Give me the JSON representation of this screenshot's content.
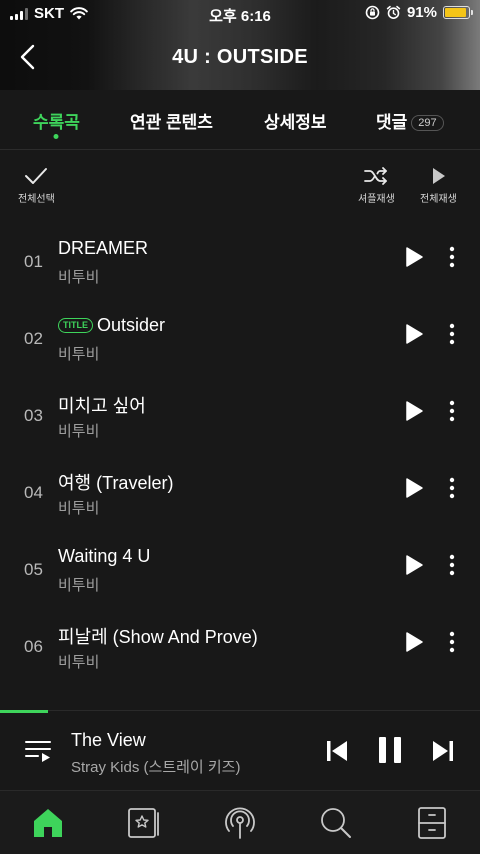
{
  "status_bar": {
    "carrier": "SKT",
    "time": "오후 6:16",
    "battery": "91%"
  },
  "header": {
    "title": "4U : OUTSIDE"
  },
  "tabs": [
    {
      "label": "수록곡",
      "active": true
    },
    {
      "label": "연관 콘텐츠",
      "active": false
    },
    {
      "label": "상세정보",
      "active": false
    },
    {
      "label": "댓글",
      "active": false,
      "count": "297"
    }
  ],
  "toolbar": {
    "select_all": "전체선택",
    "shuffle": "셔플재생",
    "play_all": "전체재생"
  },
  "tracks": [
    {
      "num": "01",
      "title": "DREAMER",
      "artist": "비투비",
      "badge": ""
    },
    {
      "num": "02",
      "title": "Outsider",
      "artist": "비투비",
      "badge": "TITLE"
    },
    {
      "num": "03",
      "title": "미치고 싶어",
      "artist": "비투비",
      "badge": ""
    },
    {
      "num": "04",
      "title": "여행 (Traveler)",
      "artist": "비투비",
      "badge": ""
    },
    {
      "num": "05",
      "title": "Waiting 4 U",
      "artist": "비투비",
      "badge": ""
    },
    {
      "num": "06",
      "title": "피날레 (Show And Prove)",
      "artist": "비투비",
      "badge": ""
    }
  ],
  "now_playing": {
    "title": "The View",
    "artist": "Stray Kids (스트레이 키즈)",
    "progress": 0.1
  },
  "bottom_nav": [
    {
      "name": "home",
      "active": true
    },
    {
      "name": "library",
      "active": false
    },
    {
      "name": "podcast",
      "active": false
    },
    {
      "name": "search",
      "active": false
    },
    {
      "name": "storage",
      "active": false
    }
  ],
  "colors": {
    "accent": "#3ed45b",
    "background": "#181818",
    "battery": "#f5c518"
  }
}
